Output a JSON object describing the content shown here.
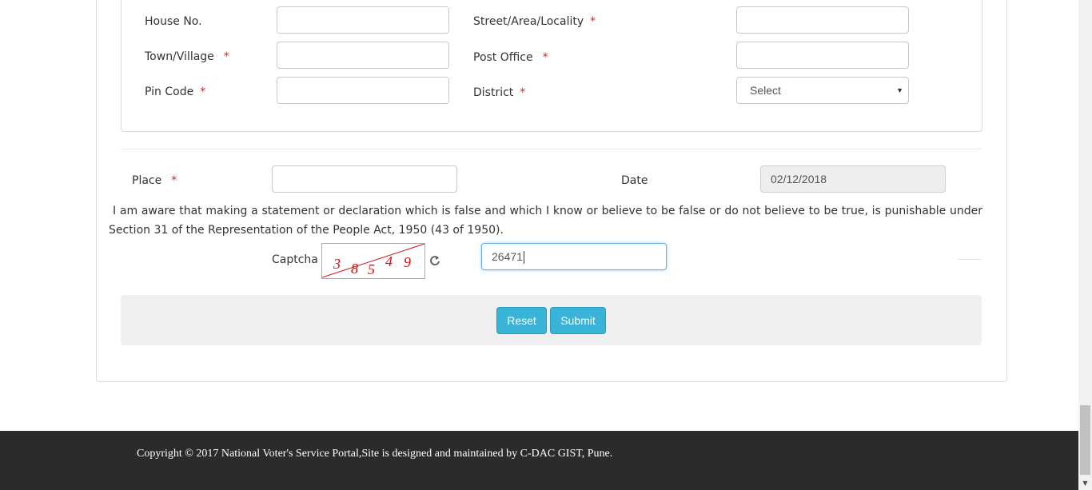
{
  "address": {
    "house_no_label": "House No.",
    "street_label": "Street/Area/Locality",
    "town_label": "Town/Village",
    "post_office_label": "Post Office",
    "pin_code_label": "Pin Code",
    "district_label": "District",
    "district_selected": "Select",
    "required_mark": "*"
  },
  "place": {
    "label": "Place",
    "required_mark": "*",
    "value": ""
  },
  "date": {
    "label": "Date",
    "value": "02/12/2018"
  },
  "declaration": "I am aware that making a statement or declaration which is false and which I know or believe to be false or do not believe to be true, is punishable under Section 31 of the Representation of the People Act, 1950 (43 of 1950).",
  "captcha": {
    "label": "Captcha",
    "digits": [
      "3",
      "8",
      "5",
      "4",
      "9"
    ],
    "input_value": "26471"
  },
  "buttons": {
    "reset": "Reset",
    "submit": "Submit"
  },
  "footer": {
    "copyright": "Copyright © 2017 National Voter's Service Portal,Site is designed and maintained by C-DAC GIST, Pune."
  },
  "colors": {
    "required": "#e02020",
    "button": "#39b3d7",
    "footer_bg": "#2b2b2b",
    "captcha_text": "#d01010"
  },
  "icons": {
    "refresh": "refresh-icon",
    "dropdown": "caret-down-icon"
  }
}
